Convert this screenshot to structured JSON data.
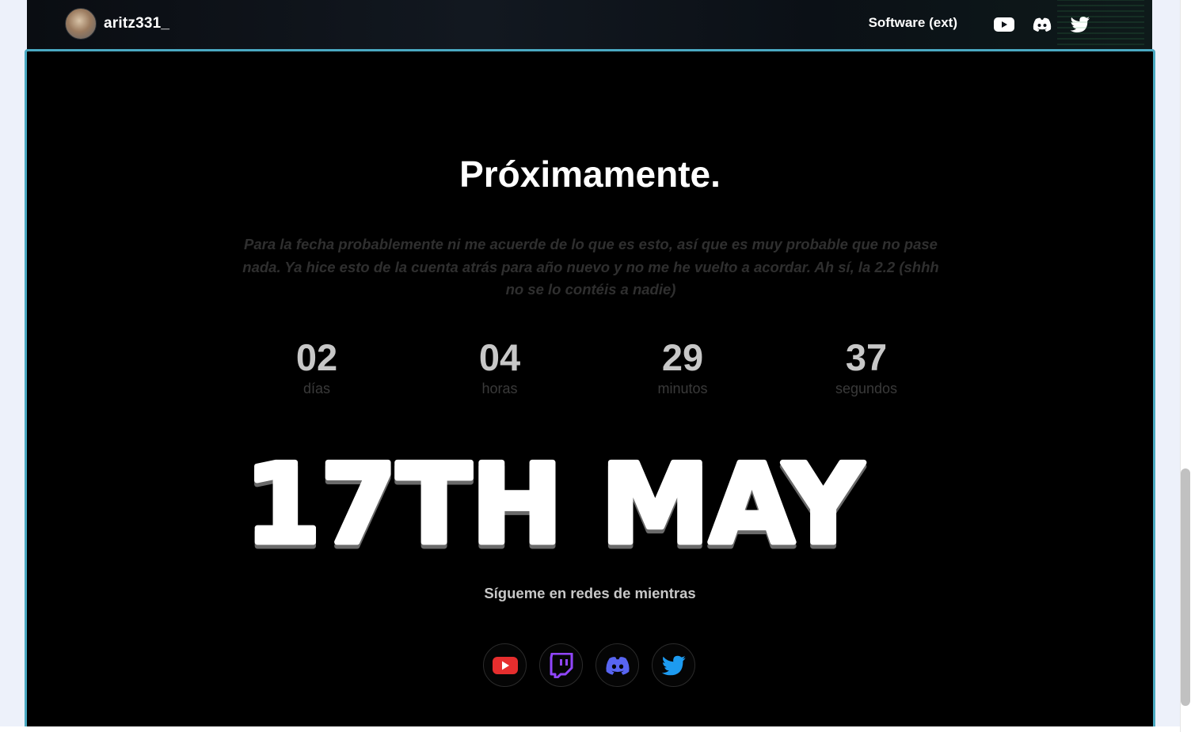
{
  "header": {
    "brand_name": "aritz331_",
    "nav_link": "Software (ext)",
    "icons": [
      "youtube-icon",
      "discord-icon",
      "twitter-icon"
    ]
  },
  "main": {
    "title": "Próximamente.",
    "description": "Para la fecha probablemente ni me acuerde de lo que es esto, así que es muy probable que no pase nada. Ya hice esto de la cuenta atrás para año nuevo y no me he vuelto a acordar. Ah sí, la 2.2 (shhh no se lo contéis a nadie)",
    "countdown": [
      {
        "value": "02",
        "label": "días"
      },
      {
        "value": "04",
        "label": "horas"
      },
      {
        "value": "29",
        "label": "minutos"
      },
      {
        "value": "37",
        "label": "segundos"
      }
    ],
    "date_graphic_text": "17TH MAY",
    "follow_text": "Sígueme en redes de mientras",
    "socials": [
      {
        "name": "youtube",
        "color": "#e62e2e"
      },
      {
        "name": "twitch",
        "color": "#9146ff"
      },
      {
        "name": "discord",
        "color": "#5865f2"
      },
      {
        "name": "twitter",
        "color": "#1d9bf0"
      }
    ]
  },
  "colors": {
    "accent_border": "#4aa9c2",
    "page_background": "#edf1fa",
    "card_background": "#000000"
  }
}
